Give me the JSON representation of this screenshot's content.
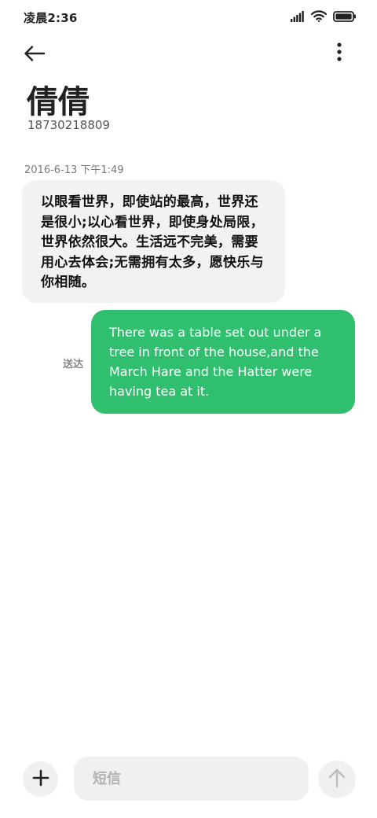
{
  "status_bar": {
    "time": "凌晨2:36",
    "icons": [
      "signal-icon",
      "wifi-icon",
      "battery-icon"
    ]
  },
  "header": {
    "back_icon": "back-arrow-icon",
    "menu_icon": "more-vertical-icon",
    "contact_name": "倩倩",
    "contact_number": "18730218809"
  },
  "conversation": {
    "timestamp": "2016-6-13 下午1:49",
    "incoming_message": "以眼看世界，即使站的最高，世界还是很小;以心看世界，即使身处局限，世界依然很大。生活远不完美，需要用心去体会;无需拥有太多，愿快乐与你相随。",
    "outgoing_message": "There was a table set out under a tree in front of the house,and the March Hare and the Hatter were having tea at it.",
    "outgoing_status": "送达"
  },
  "composer": {
    "add_icon": "plus-icon",
    "placeholder": "短信",
    "value": "",
    "send_icon": "send-arrow-up-icon"
  },
  "colors": {
    "outgoing_bubble": "#2fbf6e",
    "incoming_bubble": "#f2f2f2",
    "background": "#ffffff"
  }
}
